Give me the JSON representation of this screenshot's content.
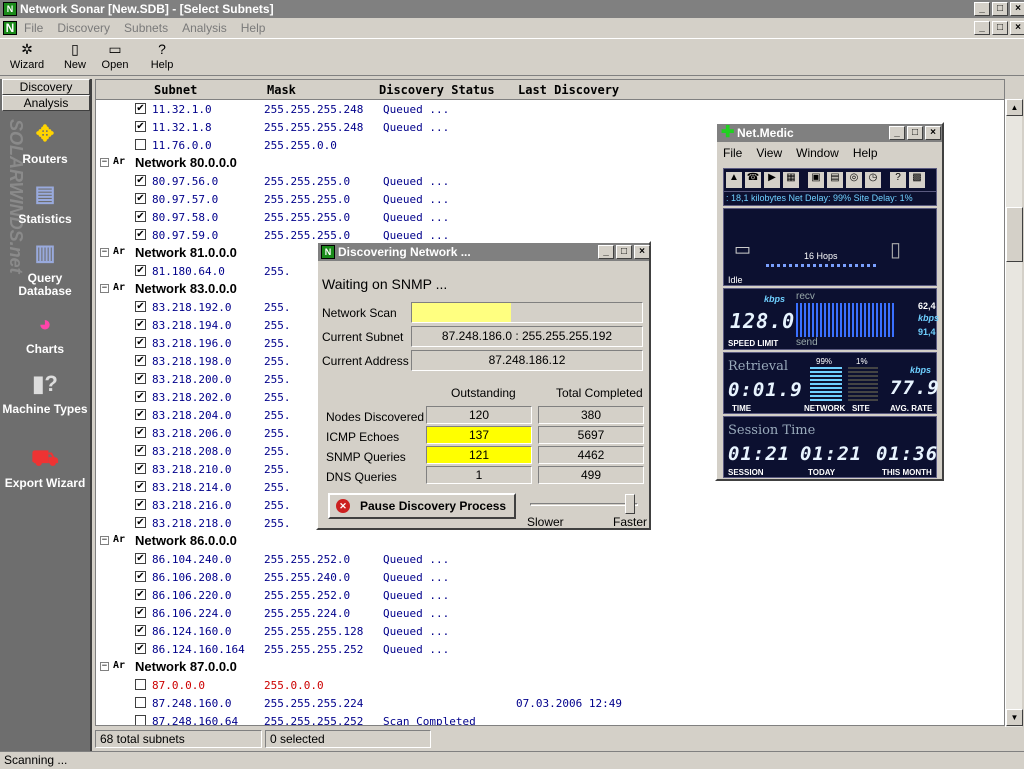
{
  "window": {
    "title": "Network Sonar [New.SDB] - [Select Subnets]"
  },
  "menu": [
    "File",
    "Discovery",
    "Subnets",
    "Analysis",
    "Help"
  ],
  "toolbar": {
    "wizard": "Wizard",
    "new": "New",
    "open": "Open",
    "help": "Help"
  },
  "sidebar": {
    "tabs": [
      "Discovery",
      "Analysis"
    ],
    "items": [
      {
        "label": "Routers",
        "icon": "routers-icon"
      },
      {
        "label": "Statistics",
        "icon": "statistics-icon"
      },
      {
        "label": "Query Database",
        "icon": "query-database-icon"
      },
      {
        "label": "Charts",
        "icon": "charts-icon"
      },
      {
        "label": "Machine Types",
        "icon": "machine-types-icon"
      },
      {
        "label": "Export Wizard",
        "icon": "export-wizard-icon"
      }
    ],
    "watermark": "SOLARWINDS.net"
  },
  "columns": [
    "Subnet",
    "Mask",
    "Discovery Status",
    "Last Discovery"
  ],
  "rows": [
    {
      "type": "s",
      "checked": true,
      "subnet": "11.32.1.0",
      "mask": "255.255.255.248",
      "status": "Queued ...",
      "last": ""
    },
    {
      "type": "s",
      "checked": true,
      "subnet": "11.32.1.8",
      "mask": "255.255.255.248",
      "status": "Queued ...",
      "last": ""
    },
    {
      "type": "s",
      "checked": false,
      "subnet": "11.76.0.0",
      "mask": "255.255.0.0",
      "status": "",
      "last": ""
    },
    {
      "type": "n",
      "label": "Network 80.0.0.0"
    },
    {
      "type": "s",
      "checked": true,
      "subnet": "80.97.56.0",
      "mask": "255.255.255.0",
      "status": "Queued ...",
      "last": ""
    },
    {
      "type": "s",
      "checked": true,
      "subnet": "80.97.57.0",
      "mask": "255.255.255.0",
      "status": "Queued ...",
      "last": ""
    },
    {
      "type": "s",
      "checked": true,
      "subnet": "80.97.58.0",
      "mask": "255.255.255.0",
      "status": "Queued ...",
      "last": ""
    },
    {
      "type": "s",
      "checked": true,
      "subnet": "80.97.59.0",
      "mask": "255.255.255.0",
      "status": "Queued ...",
      "last": ""
    },
    {
      "type": "n",
      "label": "Network 81.0.0.0"
    },
    {
      "type": "s",
      "checked": true,
      "subnet": "81.180.64.0",
      "mask": "255.",
      "status": "",
      "last": ""
    },
    {
      "type": "n",
      "label": "Network 83.0.0.0"
    },
    {
      "type": "s",
      "checked": true,
      "subnet": "83.218.192.0",
      "mask": "255.",
      "status": "",
      "last": ""
    },
    {
      "type": "s",
      "checked": true,
      "subnet": "83.218.194.0",
      "mask": "255.",
      "status": "",
      "last": ""
    },
    {
      "type": "s",
      "checked": true,
      "subnet": "83.218.196.0",
      "mask": "255.",
      "status": "",
      "last": ""
    },
    {
      "type": "s",
      "checked": true,
      "subnet": "83.218.198.0",
      "mask": "255.",
      "status": "",
      "last": ""
    },
    {
      "type": "s",
      "checked": true,
      "subnet": "83.218.200.0",
      "mask": "255.",
      "status": "",
      "last": ""
    },
    {
      "type": "s",
      "checked": true,
      "subnet": "83.218.202.0",
      "mask": "255.",
      "status": "",
      "last": ""
    },
    {
      "type": "s",
      "checked": true,
      "subnet": "83.218.204.0",
      "mask": "255.",
      "status": "",
      "last": ""
    },
    {
      "type": "s",
      "checked": true,
      "subnet": "83.218.206.0",
      "mask": "255.",
      "status": "",
      "last": ""
    },
    {
      "type": "s",
      "checked": true,
      "subnet": "83.218.208.0",
      "mask": "255.",
      "status": "",
      "last": ""
    },
    {
      "type": "s",
      "checked": true,
      "subnet": "83.218.210.0",
      "mask": "255.",
      "status": "",
      "last": ""
    },
    {
      "type": "s",
      "checked": true,
      "subnet": "83.218.214.0",
      "mask": "255.",
      "status": "",
      "last": ""
    },
    {
      "type": "s",
      "checked": true,
      "subnet": "83.218.216.0",
      "mask": "255.",
      "status": "",
      "last": ""
    },
    {
      "type": "s",
      "checked": true,
      "subnet": "83.218.218.0",
      "mask": "255.",
      "status": "",
      "last": ""
    },
    {
      "type": "n",
      "label": "Network 86.0.0.0"
    },
    {
      "type": "s",
      "checked": true,
      "subnet": "86.104.240.0",
      "mask": "255.255.252.0",
      "status": "Queued ...",
      "last": ""
    },
    {
      "type": "s",
      "checked": true,
      "subnet": "86.106.208.0",
      "mask": "255.255.240.0",
      "status": "Queued ...",
      "last": ""
    },
    {
      "type": "s",
      "checked": true,
      "subnet": "86.106.220.0",
      "mask": "255.255.252.0",
      "status": "Queued ...",
      "last": ""
    },
    {
      "type": "s",
      "checked": true,
      "subnet": "86.106.224.0",
      "mask": "255.255.224.0",
      "status": "Queued ...",
      "last": ""
    },
    {
      "type": "s",
      "checked": true,
      "subnet": "86.124.160.0",
      "mask": "255.255.255.128",
      "status": "Queued ...",
      "last": ""
    },
    {
      "type": "s",
      "checked": true,
      "subnet": "86.124.160.164",
      "mask": "255.255.255.252",
      "status": "Queued ...",
      "last": ""
    },
    {
      "type": "n",
      "label": "Network 87.0.0.0"
    },
    {
      "type": "s",
      "checked": false,
      "subnet": "87.0.0.0",
      "mask": "255.0.0.0",
      "status": "",
      "last": "",
      "red": true
    },
    {
      "type": "s",
      "checked": false,
      "subnet": "87.248.160.0",
      "mask": "255.255.255.224",
      "status": "",
      "last": "07.03.2006 12:49"
    },
    {
      "type": "s",
      "checked": false,
      "subnet": "87.248.160.64",
      "mask": "255.255.255.252",
      "status": "Scan Completed",
      "last": ""
    }
  ],
  "statusbar": {
    "total": "68 total subnets",
    "selected": "0 selected",
    "scanning": "Scanning ..."
  },
  "dialog": {
    "title": "Discovering Network ...",
    "waiting": "Waiting on SNMP ...",
    "network_scan_label": "Network Scan",
    "network_scan_progress": 0.43,
    "current_subnet_label": "Current Subnet",
    "current_subnet": "87.248.186.0 : 255.255.255.192",
    "current_address_label": "Current Address",
    "current_address": "87.248.186.12",
    "col_outstanding": "Outstanding",
    "col_total": "Total Completed",
    "stats": [
      {
        "label": "Nodes Discovered",
        "outstanding": "120",
        "total": "380",
        "highlight": false
      },
      {
        "label": "ICMP Echoes",
        "outstanding": "137",
        "total": "5697",
        "highlight": true
      },
      {
        "label": "SNMP Queries",
        "outstanding": "121",
        "total": "4462",
        "highlight": true
      },
      {
        "label": "DNS Queries",
        "outstanding": "1",
        "total": "499",
        "highlight": false
      }
    ],
    "pause_button": "Pause Discovery Process",
    "slower": "Slower",
    "faster": "Faster",
    "speed": 0.95
  },
  "netmedic": {
    "title": "Net.Medic",
    "menu": [
      "File",
      "View",
      "Window",
      "Help"
    ],
    "info": ": 18,1 kilobytes  Net Delay: 99%  Site Delay: 1%",
    "hops": "16 Hops",
    "idle": "Idle",
    "kbps": "kbps",
    "speed": "128.0",
    "speed_limit": "SPEED LIMIT",
    "recv": "recv",
    "send": "send",
    "recv_val": "62,4",
    "send_val": "91,4",
    "retrieval": "Retrieval",
    "retrieval_time": "0:01.9",
    "time_label": "TIME",
    "network_pct": "99%",
    "site_pct": "1%",
    "network_label": "NETWORK",
    "site_label": "SITE",
    "avg_rate": "77.9",
    "avg_rate_label": "AVG. RATE",
    "session_time_label": "Session Time",
    "session": "01:21",
    "today": "01:21",
    "month": "01:36",
    "session_label": "SESSION",
    "today_label": "TODAY",
    "month_label": "THIS MONTH"
  },
  "colors": {
    "link_blue": "#00008b",
    "highlight_yellow": "#ffff00",
    "progress_yellow": "#ffff80",
    "lcd_bg": "#0c1030"
  }
}
